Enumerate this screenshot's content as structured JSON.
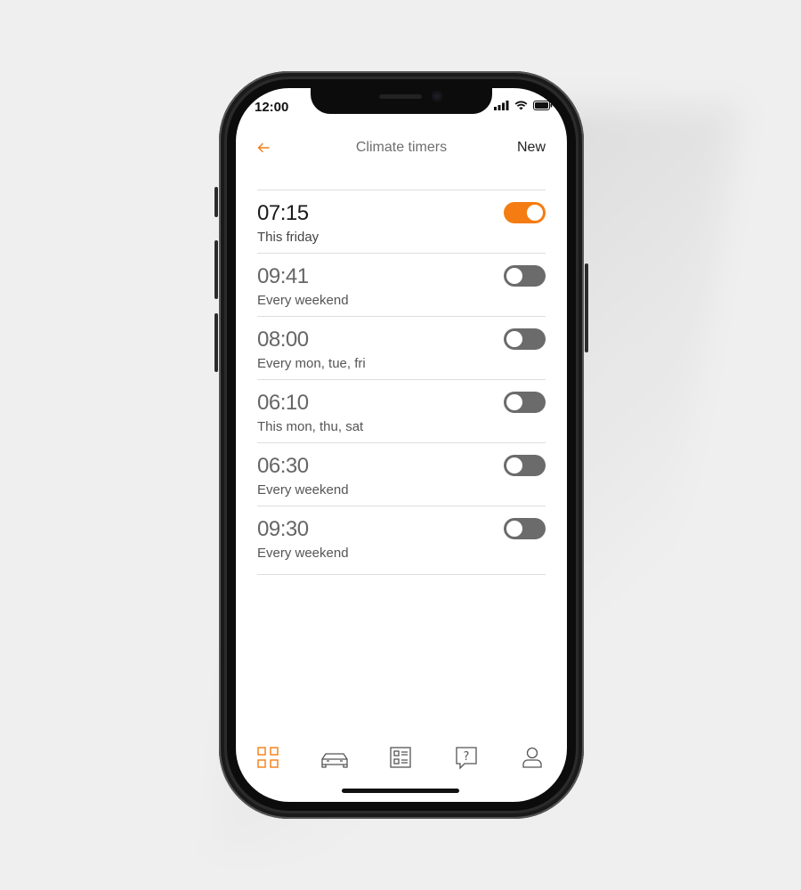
{
  "status": {
    "time": "12:00"
  },
  "header": {
    "title": "Climate timers",
    "new_label": "New",
    "back_icon": "arrow-left-icon"
  },
  "timers": [
    {
      "time": "07:15",
      "desc": "This friday",
      "enabled": true
    },
    {
      "time": "09:41",
      "desc": "Every weekend",
      "enabled": false
    },
    {
      "time": "08:00",
      "desc": "Every mon, tue, fri",
      "enabled": false
    },
    {
      "time": "06:10",
      "desc": "This mon, thu, sat",
      "enabled": false
    },
    {
      "time": "06:30",
      "desc": "Every weekend",
      "enabled": false
    },
    {
      "time": "09:30",
      "desc": "Every weekend",
      "enabled": false
    }
  ],
  "tabs": [
    {
      "icon": "grid-icon",
      "active": true
    },
    {
      "icon": "car-icon",
      "active": false
    },
    {
      "icon": "list-icon",
      "active": false
    },
    {
      "icon": "help-icon",
      "active": false
    },
    {
      "icon": "user-icon",
      "active": false
    }
  ],
  "colors": {
    "accent": "#f57c12",
    "toggle_off": "#6b6b6b",
    "tab_inactive": "#555555"
  }
}
